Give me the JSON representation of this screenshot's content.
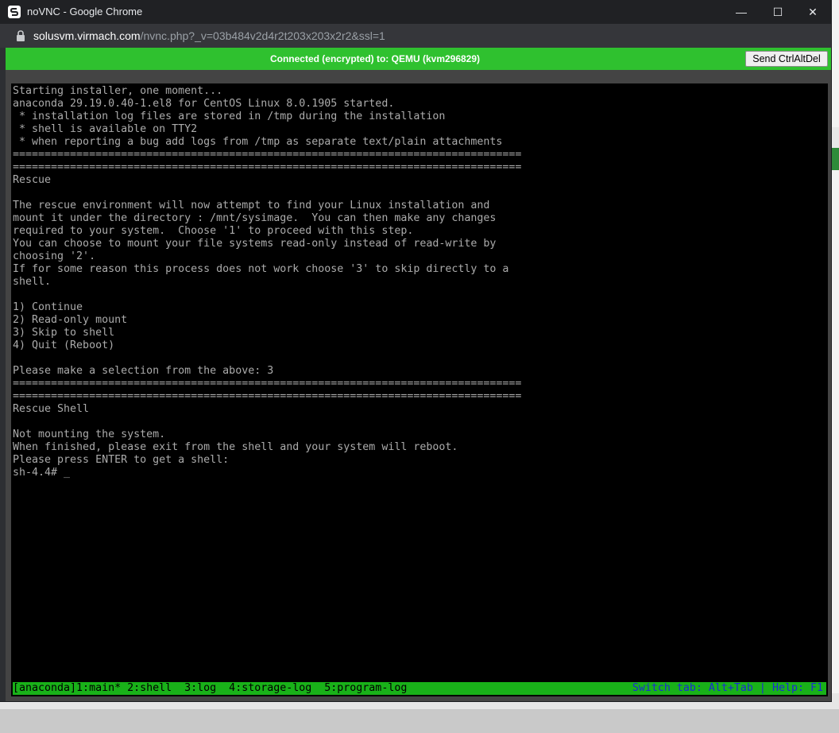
{
  "window": {
    "title": "noVNC - Google Chrome",
    "minimize": "—",
    "maximize": "☐",
    "close": "✕"
  },
  "address_bar": {
    "domain": "solusvm.virmach.com",
    "path": "/nvnc.php?_v=03b484v2d4r2t203x203x2r2&ssl=1"
  },
  "vnc": {
    "status": "Connected (encrypted) to: QEMU (kvm296829)",
    "send_ctrlaltdel": "Send CtrlAltDel",
    "status_color": "#2fc12f"
  },
  "terminal": {
    "lines": "Starting installer, one moment...\nanaconda 29.19.0.40-1.el8 for CentOS Linux 8.0.1905 started.\n * installation log files are stored in /tmp during the installation\n * shell is available on TTY2\n * when reporting a bug add logs from /tmp as separate text/plain attachments\n================================================================================\n================================================================================\nRescue\n\nThe rescue environment will now attempt to find your Linux installation and\nmount it under the directory : /mnt/sysimage.  You can then make any changes\nrequired to your system.  Choose '1' to proceed with this step.\nYou can choose to mount your file systems read-only instead of read-write by\nchoosing '2'.\nIf for some reason this process does not work choose '3' to skip directly to a\nshell.\n\n1) Continue\n2) Read-only mount\n3) Skip to shell\n4) Quit (Reboot)\n\nPlease make a selection from the above: 3\n================================================================================\n================================================================================\nRescue Shell\n\nNot mounting the system.\nWhen finished, please exit from the shell and your system will reboot.\nPlease press ENTER to get a shell:\nsh-4.4# ",
    "cursor": "_",
    "tmux_left": "[anaconda]1:main* 2:shell  3:log  4:storage-log  5:program-log",
    "tmux_right": "Switch tab: Alt+Tab | Help: F1"
  }
}
